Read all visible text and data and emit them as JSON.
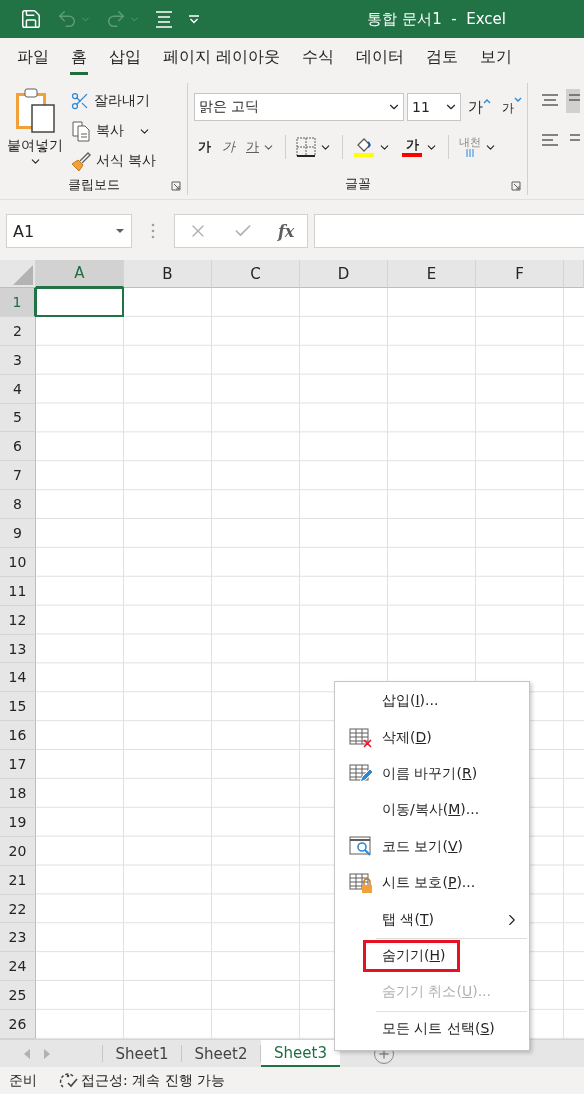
{
  "title_bar": {
    "title": "통합 문서1  -  Excel",
    "quick_access": [
      {
        "kind": "save",
        "disabled": false
      },
      {
        "kind": "undo",
        "disabled": true
      },
      {
        "kind": "redo",
        "disabled": true
      },
      {
        "kind": "touch",
        "disabled": false
      },
      {
        "kind": "customize",
        "disabled": false
      }
    ]
  },
  "ribbon_tabs": [
    {
      "label": "파일",
      "selected": false
    },
    {
      "label": "홈",
      "selected": true
    },
    {
      "label": "삽입",
      "selected": false
    },
    {
      "label": "페이지 레이아웃",
      "selected": false
    },
    {
      "label": "수식",
      "selected": false
    },
    {
      "label": "데이터",
      "selected": false
    },
    {
      "label": "검토",
      "selected": false
    },
    {
      "label": "보기",
      "selected": false
    }
  ],
  "clipboard": {
    "title": "클립보드",
    "paste": "붙여넣기",
    "items": [
      {
        "kind": "cut",
        "label": "잘라내기",
        "dropdown": false
      },
      {
        "kind": "copy",
        "label": "복사",
        "dropdown": true
      },
      {
        "kind": "format_painter",
        "label": "서식 복사",
        "dropdown": false
      }
    ]
  },
  "font": {
    "title": "글꼴",
    "font_name": "맑은 고딕",
    "font_size": "11",
    "size_buttons": [
      {
        "kind": "grow",
        "label": "가"
      },
      {
        "kind": "shrink",
        "label": "가"
      }
    ],
    "format_buttons": [
      {
        "kind": "bold",
        "label": "가",
        "dropdown": false
      },
      {
        "kind": "italic",
        "label": "가",
        "dropdown": false
      },
      {
        "kind": "underline",
        "label": "가",
        "dropdown": true
      },
      {
        "kind": "borders",
        "dropdown": true
      },
      {
        "kind": "fill_color",
        "color": "#ffff00",
        "dropdown": true
      },
      {
        "kind": "font_color",
        "label": "가",
        "color": "#ff0000",
        "dropdown": true
      },
      {
        "kind": "phonetic",
        "label": "내천",
        "dropdown": true
      }
    ]
  },
  "formula_bar": {
    "name_box": "A1",
    "buttons": [
      {
        "kind": "cancel",
        "disabled": true
      },
      {
        "kind": "enter",
        "disabled": true
      },
      {
        "kind": "function",
        "label": "fx",
        "disabled": false
      }
    ]
  },
  "grid": {
    "columns": [
      {
        "label": "A",
        "selected": true
      },
      {
        "label": "B",
        "selected": false
      },
      {
        "label": "C",
        "selected": false
      },
      {
        "label": "D",
        "selected": false
      },
      {
        "label": "E",
        "selected": false
      },
      {
        "label": "F",
        "selected": false
      }
    ],
    "rows": [
      {
        "label": "1",
        "selected": true
      },
      {
        "label": "2",
        "selected": false
      },
      {
        "label": "3",
        "selected": false
      },
      {
        "label": "4",
        "selected": false
      },
      {
        "label": "5",
        "selected": false
      },
      {
        "label": "6",
        "selected": false
      },
      {
        "label": "7",
        "selected": false
      },
      {
        "label": "8",
        "selected": false
      },
      {
        "label": "9",
        "selected": false
      },
      {
        "label": "10",
        "selected": false
      },
      {
        "label": "11",
        "selected": false
      },
      {
        "label": "12",
        "selected": false
      },
      {
        "label": "13",
        "selected": false
      },
      {
        "label": "14",
        "selected": false
      },
      {
        "label": "15",
        "selected": false
      },
      {
        "label": "16",
        "selected": false
      },
      {
        "label": "17",
        "selected": false
      },
      {
        "label": "18",
        "selected": false
      },
      {
        "label": "19",
        "selected": false
      },
      {
        "label": "20",
        "selected": false
      },
      {
        "label": "21",
        "selected": false
      },
      {
        "label": "22",
        "selected": false
      },
      {
        "label": "23",
        "selected": false
      },
      {
        "label": "24",
        "selected": false
      },
      {
        "label": "25",
        "selected": false
      },
      {
        "label": "26",
        "selected": false
      }
    ]
  },
  "context_menu": [
    {
      "kind": "plain",
      "label": "삽입(",
      "key": "I",
      "rest": ")...",
      "separator_before": false,
      "highlighted": false,
      "disabled": false
    },
    {
      "kind": "delete",
      "label": "삭제(",
      "key": "D",
      "rest": ")",
      "separator_before": false,
      "highlighted": false,
      "disabled": false
    },
    {
      "kind": "rename",
      "label": "이름 바꾸기(",
      "key": "R",
      "rest": ")",
      "separator_before": false,
      "highlighted": false,
      "disabled": false
    },
    {
      "kind": "plain",
      "label": "이동/복사(",
      "key": "M",
      "rest": ")...",
      "separator_before": false,
      "highlighted": false,
      "disabled": false
    },
    {
      "kind": "code",
      "label": "코드 보기(",
      "key": "V",
      "rest": ")",
      "separator_before": false,
      "highlighted": false,
      "disabled": false
    },
    {
      "kind": "protect",
      "label": "시트 보호(",
      "key": "P",
      "rest": ")...",
      "separator_before": false,
      "highlighted": false,
      "disabled": false
    },
    {
      "kind": "submenu",
      "label": "탭 색(",
      "key": "T",
      "rest": ")",
      "separator_before": false,
      "highlighted": false,
      "disabled": false
    },
    {
      "kind": "plain",
      "label": "숨기기(",
      "key": "H",
      "rest": ")",
      "separator_before": true,
      "highlighted": true,
      "disabled": false
    },
    {
      "kind": "plain",
      "label": "숨기기 취소(",
      "key": "U",
      "rest": ")...",
      "separator_before": false,
      "highlighted": false,
      "disabled": true
    },
    {
      "kind": "plain",
      "label": "모든 시트 선택(",
      "key": "S",
      "rest": ")",
      "separator_before": true,
      "highlighted": false,
      "disabled": false
    }
  ],
  "sheet_tabs": {
    "nav": [
      {
        "kind": "prev",
        "disabled": true
      },
      {
        "kind": "next",
        "disabled": true
      }
    ],
    "tabs": [
      {
        "label": "Sheet1",
        "selected": false
      },
      {
        "label": "Sheet2",
        "selected": false
      },
      {
        "label": "Sheet3",
        "selected": true
      }
    ]
  },
  "status_bar": {
    "mode": "준비",
    "accessibility": "접근성: 계속 진행 가능"
  }
}
